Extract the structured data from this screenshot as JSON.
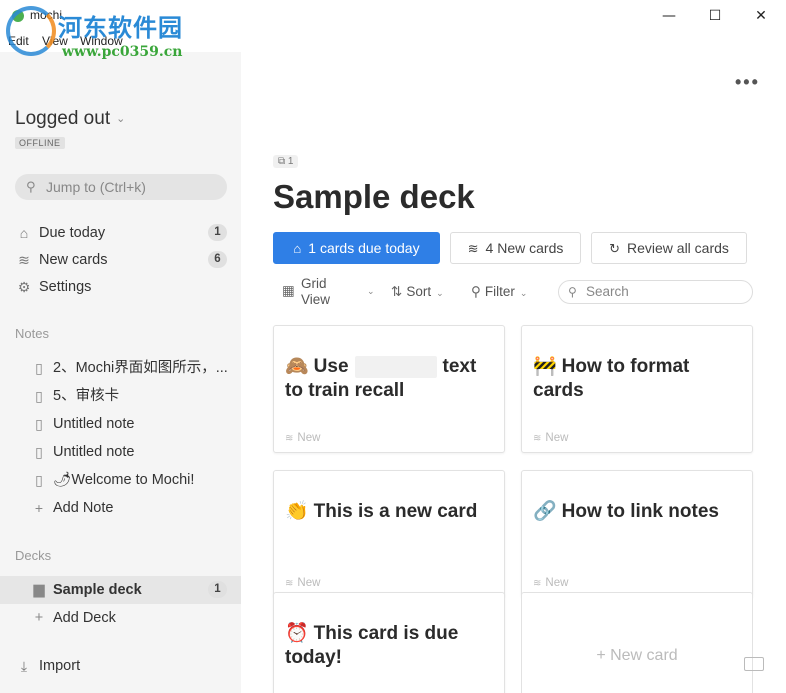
{
  "window": {
    "title": "mochi",
    "minimize": "—",
    "maximize": "☐",
    "close": "✕"
  },
  "menu": [
    "Edit",
    "View",
    "Window"
  ],
  "watermark": {
    "chinese": "河东软件园",
    "url": "www.pc0359.cn"
  },
  "sidebar": {
    "account": "Logged out",
    "status": "OFFLINE",
    "jump_placeholder": "Jump to (Ctrl+k)",
    "nav": [
      {
        "label": "Due today",
        "badge": "1",
        "icon": "inbox-icon"
      },
      {
        "label": "New cards",
        "badge": "6",
        "icon": "layers-icon"
      },
      {
        "label": "Settings",
        "badge": "",
        "icon": "gear-icon"
      }
    ],
    "notes_header": "Notes",
    "notes": [
      "2、Mochi界面如图所示，...",
      "5、审核卡",
      "Untitled note",
      "Untitled note",
      "🌶Welcome to Mochi!"
    ],
    "add_note": "Add Note",
    "decks_header": "Decks",
    "decks": [
      {
        "label": "Sample deck",
        "badge": "1"
      }
    ],
    "add_deck": "Add Deck",
    "import": "Import"
  },
  "main": {
    "more": "•••",
    "count_chip": "1",
    "deck_title": "Sample deck",
    "buttons": {
      "due": "1 cards due today",
      "new": "4 New cards",
      "review": "Review all cards"
    },
    "toolbar": {
      "view_line1": "Grid",
      "view_line2": "View",
      "sort": "Sort",
      "filter": "Filter",
      "search_placeholder": "Search"
    },
    "cards": [
      {
        "emoji": "🙈",
        "title_pre": "Use",
        "title_post": "text to train recall",
        "status": "New"
      },
      {
        "emoji": "🚧",
        "title": "How to format cards",
        "status": "New"
      },
      {
        "emoji": "👏",
        "title": "This is a new card",
        "status": "New"
      },
      {
        "emoji": "🔗",
        "title": "How to link notes",
        "status": "New"
      },
      {
        "emoji": "⏰",
        "title": "This card is due today!",
        "status": ""
      }
    ],
    "new_card": "+ New card"
  },
  "colors": {
    "accent": "#2f7fe6",
    "sidebar_bg": "#f5f5f5"
  }
}
